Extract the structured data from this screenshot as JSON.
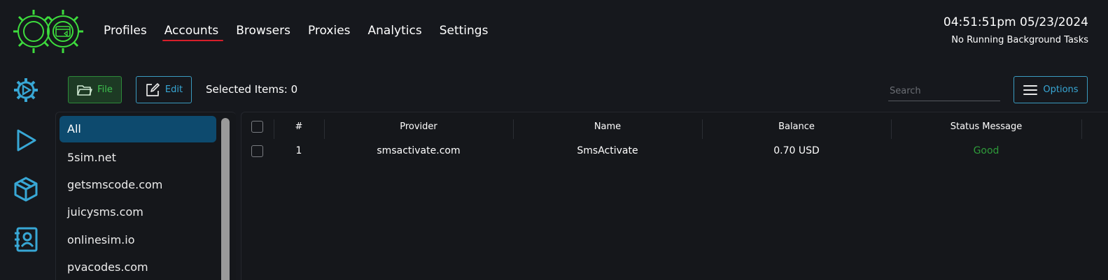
{
  "nav": {
    "items": [
      {
        "label": "Profiles",
        "active": false
      },
      {
        "label": "Accounts",
        "active": true
      },
      {
        "label": "Browsers",
        "active": false
      },
      {
        "label": "Proxies",
        "active": false
      },
      {
        "label": "Analytics",
        "active": false
      },
      {
        "label": "Settings",
        "active": false
      }
    ]
  },
  "clock": {
    "time": "04:51:51pm 05/23/2024",
    "status": "No Running Background Tasks"
  },
  "rail": {
    "icons": [
      "gear-play-icon",
      "play-icon",
      "cube-icon",
      "contacts-icon"
    ]
  },
  "toolbar": {
    "file_label": "File",
    "edit_label": "Edit",
    "selected_items": "Selected Items: 0",
    "search_placeholder": "Search",
    "options_label": "Options"
  },
  "sidebar": {
    "items": [
      {
        "label": "All",
        "active": true
      },
      {
        "label": "5sim.net",
        "active": false
      },
      {
        "label": "getsmscode.com",
        "active": false
      },
      {
        "label": "juicysms.com",
        "active": false
      },
      {
        "label": "onlinesim.io",
        "active": false
      },
      {
        "label": "pvacodes.com",
        "active": false
      }
    ]
  },
  "table": {
    "columns": [
      "#",
      "Provider",
      "Name",
      "Balance",
      "Status Message"
    ],
    "rows": [
      {
        "num": "1",
        "provider": "smsactivate.com",
        "name": "SmsActivate",
        "balance": "0.70 USD",
        "status": "Good"
      }
    ]
  },
  "colors": {
    "accent": "#38a7d5",
    "active_underline": "#d81f2a",
    "file_green": "#3ec24f",
    "logo_green": "#3ddc3d",
    "status_good": "#2e9a3a",
    "sidebar_active": "#0d4a6e"
  }
}
